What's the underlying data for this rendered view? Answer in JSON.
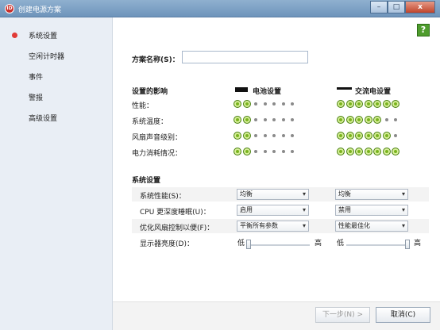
{
  "window": {
    "title": "创建电源方案",
    "minimize": "–",
    "maximize": "□",
    "close": "x"
  },
  "sidebar": {
    "items": [
      {
        "label": "系统设置",
        "selected": true
      },
      {
        "label": "空闲计时器"
      },
      {
        "label": "事件"
      },
      {
        "label": "警报"
      },
      {
        "label": "高级设置"
      }
    ]
  },
  "help": {
    "label": "?"
  },
  "form": {
    "plan_name_label": "方案名称(S)：",
    "plan_name_value": ""
  },
  "impact": {
    "heading": "设置的影响",
    "battery_label": "电池设置",
    "ac_label": "交流电设置",
    "rows": [
      {
        "label": "性能：",
        "battery_level": 2,
        "ac_level": 7
      },
      {
        "label": "系统温度：",
        "battery_level": 2,
        "ac_level": 5
      },
      {
        "label": "风扇声音级别：",
        "battery_level": 2,
        "ac_level": 6
      },
      {
        "label": "电力消耗情况：",
        "battery_level": 2,
        "ac_level": 7
      }
    ],
    "dot_count": 7
  },
  "system": {
    "heading": "系统设置",
    "rows": [
      {
        "label": "系统性能(S)：",
        "battery": "均衡",
        "ac": "均衡"
      },
      {
        "label": "CPU 更深度睡眠(U)：",
        "battery": "启用",
        "ac": "禁用"
      },
      {
        "label": "优化风扇控制以便(F)：",
        "battery": "平衡所有参数",
        "ac": "性能最佳化"
      }
    ],
    "brightness": {
      "label": "显示器亮度(D)：",
      "low": "低",
      "high": "高",
      "battery_value": 0,
      "ac_value": 100
    }
  },
  "buttons": {
    "next": "下一步(N) >",
    "cancel": "取消(C)"
  },
  "colors": {
    "accent": "#7ab31f",
    "selected_dot": "#e13b37"
  }
}
